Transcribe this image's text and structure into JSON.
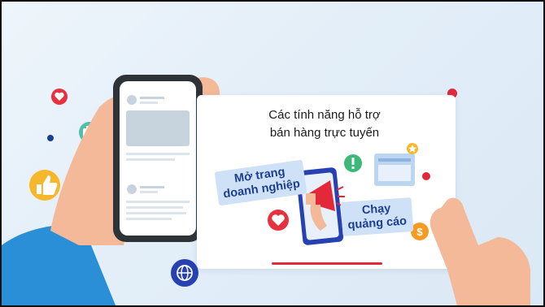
{
  "card": {
    "title_line1": "Các tính năng hỗ trợ",
    "title_line2": "bán hàng trực tuyến"
  },
  "tags": {
    "page_line1": "Mở trang",
    "page_line2": "doanh nghiệp",
    "ads_line1": "Chạy",
    "ads_line2": "quảng cáo"
  },
  "colors": {
    "accent_red": "#e3283a",
    "brand_blue": "#1c3f8f",
    "tag_bg": "#cfe1f7",
    "heart_red": "#e6313f",
    "globe_blue": "#2541b2",
    "like_yellow": "#f6b72a",
    "coin_orange": "#f59b23",
    "alert_green": "#3cb878",
    "camera_teal": "#4ebfa8"
  },
  "icons": [
    "heart-icon",
    "camera-icon",
    "thumbs-up-icon",
    "globe-icon",
    "megaphone-icon",
    "alert-icon",
    "star-icon",
    "percent-icon",
    "dollar-icon"
  ]
}
